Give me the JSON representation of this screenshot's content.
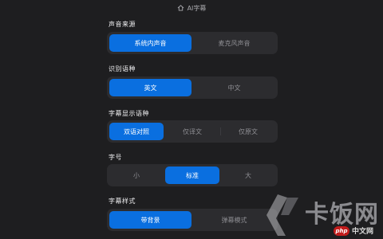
{
  "window": {
    "title": "AI字幕",
    "title_icon": "home-icon"
  },
  "sections": [
    {
      "label": "声音来源",
      "options": [
        "系统内声音",
        "麦克风声音"
      ],
      "selected": 0
    },
    {
      "label": "识别语种",
      "options": [
        "英文",
        "中文"
      ],
      "selected": 0
    },
    {
      "label": "字幕显示语种",
      "options": [
        "双语对照",
        "仅译文",
        "仅原文"
      ],
      "selected": 0
    },
    {
      "label": "字号",
      "options": [
        "小",
        "标准",
        "大"
      ],
      "selected": 1
    },
    {
      "label": "字幕样式",
      "options": [
        "带背景",
        "弹幕模式"
      ],
      "selected": 0
    }
  ],
  "watermark": {
    "text": "卡饭网"
  },
  "badge": {
    "logo": "php",
    "site": "中文网"
  },
  "colors": {
    "accent": "#0a6fe0",
    "background": "#1e1e20",
    "segment": "#2c2c2f"
  }
}
